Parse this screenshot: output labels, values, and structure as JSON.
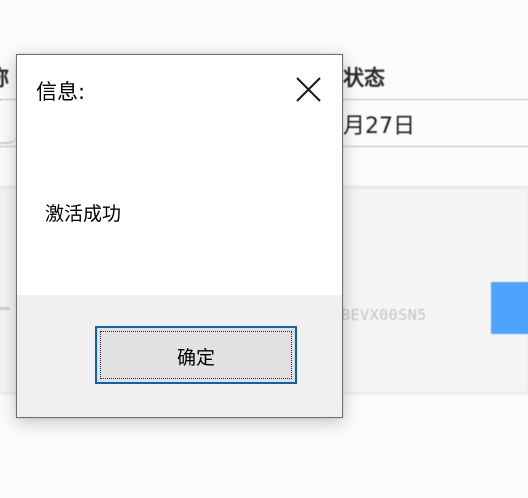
{
  "background_window": {
    "column_header_left": "称",
    "column_header_status": "状态",
    "row_date": "月27日",
    "blurred_code": "BEVX00SN5",
    "accent_color": "#4da3ff"
  },
  "dialog": {
    "title": "信息:",
    "close_icon": "close-icon",
    "message": "激活成功",
    "ok_label": "确定",
    "border_color": "#0a64b4"
  }
}
